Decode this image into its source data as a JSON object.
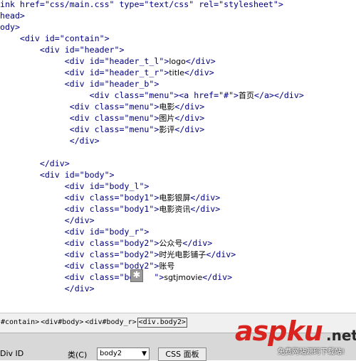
{
  "editor": {
    "lines": [
      {
        "before": "ink href=\"css/main.css\" type=\"text/css\" rel=\"stylesheet\">",
        "text": "",
        "after": ""
      },
      {
        "before": "head>",
        "text": "",
        "after": ""
      },
      {
        "before": "ody>",
        "text": "",
        "after": ""
      },
      {
        "before": "    <div id=\"contain\">",
        "text": "",
        "after": ""
      },
      {
        "before": "        <div id=\"header\">",
        "text": "",
        "after": ""
      },
      {
        "before": "             <div id=\"header_t_l\">",
        "text": "logo",
        "after": "</div>"
      },
      {
        "before": "             <div id=\"header_t_r\">",
        "text": "title",
        "after": "</div>"
      },
      {
        "before": "             <div id=\"header_b\">",
        "text": "",
        "after": ""
      },
      {
        "before": "                  <div class=\"menu\"><a href=\"#\">",
        "text": "首页",
        "after": "</a></div>"
      },
      {
        "before": "              <div class=\"menu\">",
        "text": "电影",
        "after": "</div>"
      },
      {
        "before": "              <div class=\"menu\">",
        "text": "图片",
        "after": "</div>"
      },
      {
        "before": "              <div class=\"menu\">",
        "text": "影评",
        "after": "</div>"
      },
      {
        "before": "              </div>",
        "text": "",
        "after": ""
      },
      {
        "before": "",
        "text": "",
        "after": ""
      },
      {
        "before": "        </div>",
        "text": "",
        "after": ""
      },
      {
        "before": "        <div id=\"body\">",
        "text": "",
        "after": ""
      },
      {
        "before": "             <div id=\"body_l\">",
        "text": "",
        "after": ""
      },
      {
        "before": "             <div class=\"body1\">",
        "text": "电影银屏",
        "after": "</div>"
      },
      {
        "before": "             <div class=\"body1\">",
        "text": "电影资讯",
        "after": "</div>"
      },
      {
        "before": "             </div>",
        "text": "",
        "after": ""
      },
      {
        "before": "             <div id=\"body_r\">",
        "text": "",
        "after": ""
      },
      {
        "before": "             <div class=\"body2\">",
        "text": "公众号",
        "after": "</div>"
      },
      {
        "before": "             <div class=\"body2\">",
        "text": "时光电影铺子",
        "after": "</div>"
      },
      {
        "before": "             <div class=\"body2\">",
        "text": "账号",
        "after": ""
      },
      {
        "before": "             <div class=\"bo    \">",
        "text": "sgtjmovie",
        "after": "</div>"
      },
      {
        "before": "             </div>",
        "text": "",
        "after": ""
      }
    ]
  },
  "tag_selector": {
    "tags": [
      "#contain>",
      "<div#body>",
      "<div#body_r>"
    ],
    "current": "<div.body2>"
  },
  "properties": {
    "div_id_label": "Div ID",
    "class_label": "类(C)",
    "class_value": "body2",
    "css_button": "CSS 面板"
  },
  "watermark": {
    "brand": "aspku",
    "tld": ".net",
    "subtitle": "免费网站源码下载站!"
  },
  "colors": {
    "tag_text": "#000080",
    "content_text": "#000000",
    "brand": "#d9231f"
  }
}
